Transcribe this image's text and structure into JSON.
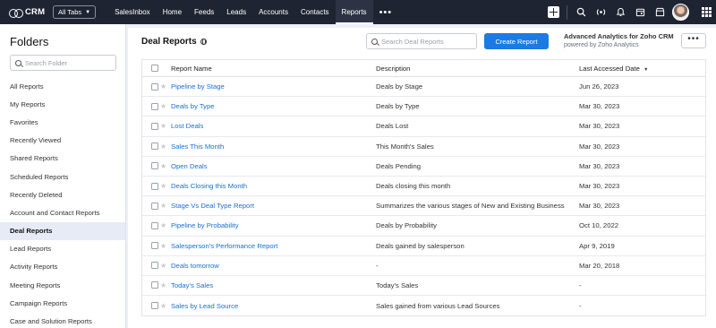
{
  "app": {
    "name": "CRM",
    "all_tabs_label": "All Tabs"
  },
  "nav": {
    "tabs": [
      {
        "label": "SalesInbox"
      },
      {
        "label": "Home"
      },
      {
        "label": "Feeds"
      },
      {
        "label": "Leads"
      },
      {
        "label": "Accounts"
      },
      {
        "label": "Contacts"
      },
      {
        "label": "Reports",
        "active": true
      }
    ],
    "more_label": "•••"
  },
  "sidebar": {
    "title": "Folders",
    "search_placeholder": "Search Folder",
    "items": [
      {
        "label": "All Reports"
      },
      {
        "label": "My Reports"
      },
      {
        "label": "Favorites"
      },
      {
        "label": "Recently Viewed"
      },
      {
        "label": "Shared Reports"
      },
      {
        "label": "Scheduled Reports"
      },
      {
        "label": "Recently Deleted"
      },
      {
        "label": "Account and Contact Reports"
      },
      {
        "label": "Deal Reports",
        "active": true
      },
      {
        "label": "Lead Reports"
      },
      {
        "label": "Activity Reports"
      },
      {
        "label": "Meeting Reports"
      },
      {
        "label": "Campaign Reports"
      },
      {
        "label": "Case and Solution Reports"
      }
    ]
  },
  "main": {
    "title": "Deal Reports",
    "search_placeholder": "Search Deal Reports",
    "create_label": "Create Report",
    "analytics_line1": "Advanced Analytics for Zoho CRM",
    "analytics_line2": "powered by Zoho Analytics",
    "more_label": "•••"
  },
  "table": {
    "columns": {
      "name": "Report Name",
      "description": "Description",
      "last_accessed": "Last Accessed Date"
    },
    "rows": [
      {
        "name": "Pipeline by Stage",
        "description": "Deals by Stage",
        "date": "Jun 26, 2023"
      },
      {
        "name": "Deals by Type",
        "description": "Deals by Type",
        "date": "Mar 30, 2023"
      },
      {
        "name": "Lost Deals",
        "description": "Deals Lost",
        "date": "Mar 30, 2023"
      },
      {
        "name": "Sales This Month",
        "description": "This Month's Sales",
        "date": "Mar 30, 2023"
      },
      {
        "name": "Open Deals",
        "description": "Deals Pending",
        "date": "Mar 30, 2023"
      },
      {
        "name": "Deals Closing this Month",
        "description": "Deals closing this month",
        "date": "Mar 30, 2023"
      },
      {
        "name": "Stage Vs Deal Type Report",
        "description": "Summarizes the various stages of New and Existing Business",
        "date": "Mar 30, 2023"
      },
      {
        "name": "Pipeline by Probability",
        "description": "Deals by Probability",
        "date": "Oct 10, 2022"
      },
      {
        "name": "Salesperson's Performance Report",
        "description": "Deals gained by salesperson",
        "date": "Apr 9, 2019"
      },
      {
        "name": "Deals tomorrow",
        "description": "-",
        "date": "Mar 20, 2018"
      },
      {
        "name": "Today's Sales",
        "description": "Today's Sales",
        "date": "-"
      },
      {
        "name": "Sales by Lead Source",
        "description": "Sales gained from various Lead Sources",
        "date": "-"
      }
    ]
  },
  "colors": {
    "topbar": "#1f2433",
    "link": "#1a6fd4",
    "primary_button": "#1c7be2",
    "active_folder": "#e6ebf5"
  }
}
